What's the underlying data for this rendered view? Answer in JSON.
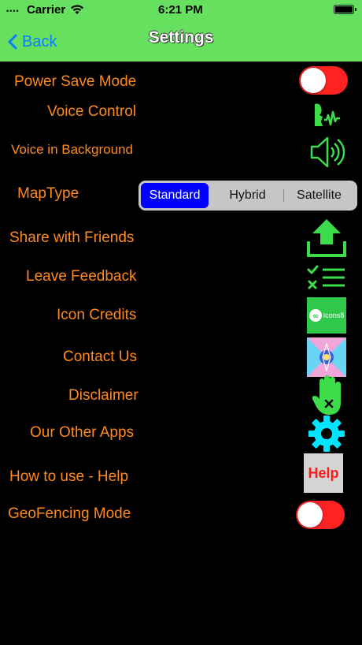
{
  "status": {
    "carrier": "Carrier",
    "time": "6:21 PM"
  },
  "nav": {
    "back_label": "Back",
    "title": "Settings"
  },
  "rows": {
    "power_save": "Power Save Mode",
    "voice_control": "Voice Control",
    "voice_background": "Voice in Background",
    "map_type": "MapType",
    "share": "Share with Friends",
    "feedback": "Leave Feedback",
    "credits": "Icon Credits",
    "contact": "Contact Us",
    "disclaimer": "Disclaimer",
    "other_apps": "Our Other Apps",
    "help": "How to use - Help",
    "geofencing": "GeoFencing Mode"
  },
  "map_type_options": {
    "selected": "Standard",
    "opt1": "Standard",
    "opt2": "Hybrid",
    "opt3": "Satellite"
  },
  "icons8_text": "Icons8",
  "help_button": "Help",
  "colors": {
    "nav_bg": "#66e05e",
    "label": "#ff8a1c",
    "toggle_off": "#ff2222",
    "segment_active": "#0000ff",
    "icon_green": "#3ddc4a",
    "icon_cyan": "#00e5ff"
  },
  "toggles": {
    "power_save_on": false,
    "geofencing_on": false
  }
}
